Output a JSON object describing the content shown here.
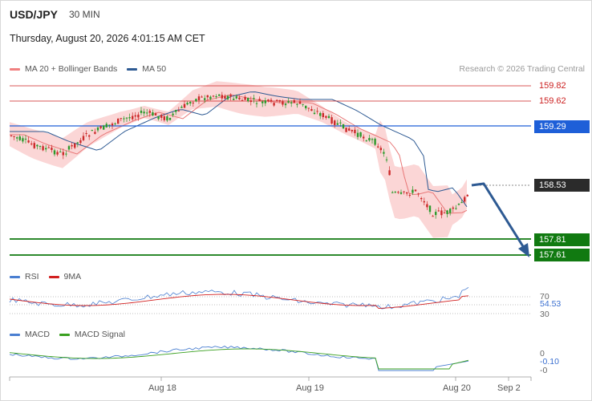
{
  "header": {
    "symbol": "USD/JPY",
    "timeframe": "30 MIN",
    "timestamp": "Thursday, August 20, 2026 4:01:15 AM CET",
    "credit": "Research © 2026 Trading Central"
  },
  "legends": {
    "main": [
      {
        "label": "MA 20 + Bollinger Bands",
        "color": "#f08080"
      },
      {
        "label": "MA 50",
        "color": "#2e5a93"
      }
    ],
    "rsi": [
      {
        "label": "RSI",
        "color": "#4a7fd1"
      },
      {
        "label": "9MA",
        "color": "#d22020"
      }
    ],
    "macd": [
      {
        "label": "MACD",
        "color": "#4a7fd1"
      },
      {
        "label": "MACD Signal",
        "color": "#3aa020"
      }
    ]
  },
  "levels": {
    "r2": {
      "value": "159.82",
      "color": "#cc2222"
    },
    "r1": {
      "value": "159.62",
      "color": "#cc2222"
    },
    "pivot": {
      "value": "159.29",
      "color": "#1e5fd8"
    },
    "last": {
      "value": "158.53",
      "color": "#333333"
    },
    "s1": {
      "value": "157.81",
      "color": "#117a11"
    },
    "s2": {
      "value": "157.61",
      "color": "#117a11"
    }
  },
  "rsi_panel": {
    "ticks": [
      "70",
      "30"
    ],
    "value": "54.53"
  },
  "macd_panel": {
    "ticks": [
      "0",
      "-0"
    ],
    "value": "-0.10"
  },
  "x_axis": {
    "ticks": [
      "Aug 18",
      "Aug 19",
      "Aug 20",
      "Sep 2"
    ]
  },
  "colors": {
    "bull": "#2c9a2c",
    "bear": "#cc2a2a",
    "band_fill": "#fbd6d6",
    "forecast_arrow": "#2e5a93"
  }
}
